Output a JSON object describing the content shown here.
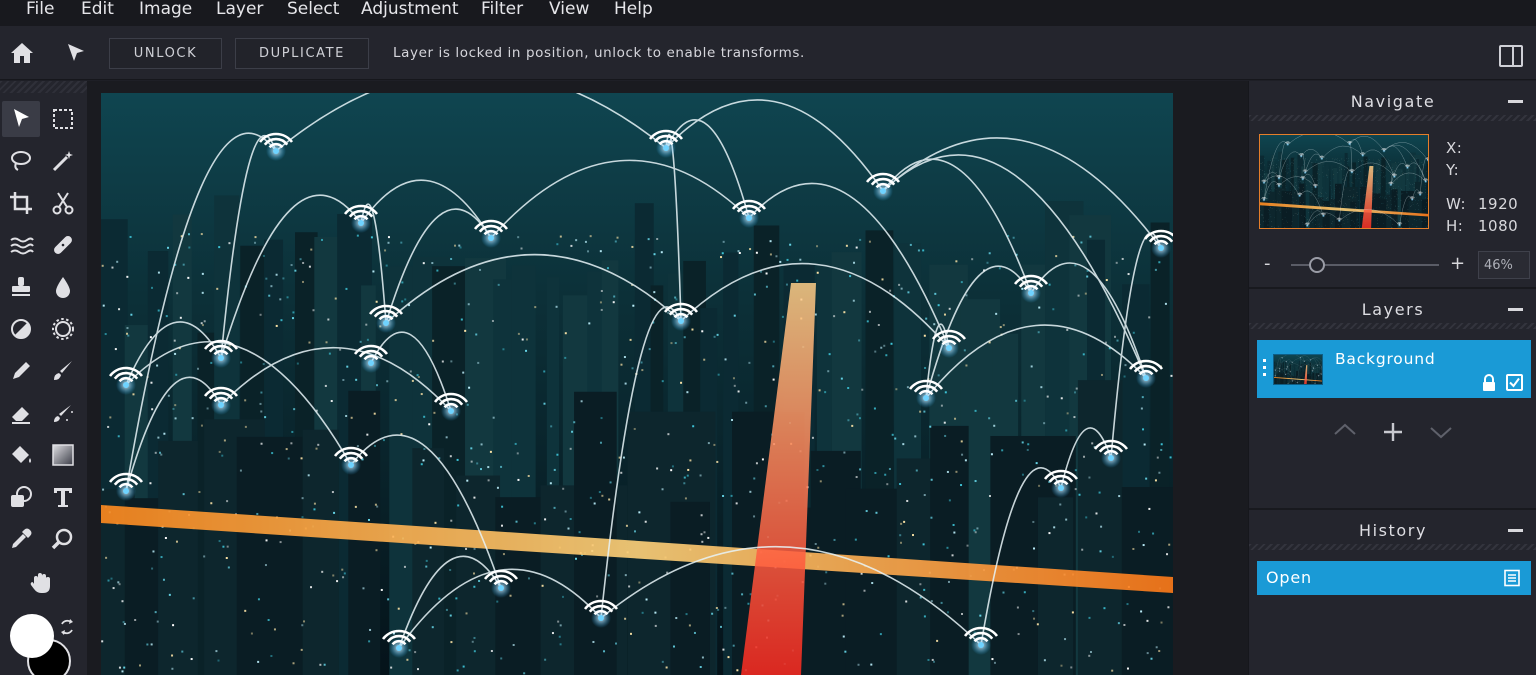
{
  "menu": [
    "File",
    "Edit",
    "Image",
    "Layer",
    "Select",
    "Adjustment",
    "Filter",
    "View",
    "Help"
  ],
  "toolbar": {
    "home_icon": "home-icon",
    "pointer_icon": "arrow-pointer-icon",
    "unlock_label": "UNLOCK",
    "duplicate_label": "DUPLICATE",
    "status_message": "Layer is locked in position, unlock to enable transforms.",
    "panel_toggle_icon": "collapse-panel-icon"
  },
  "tools": [
    "move-icon",
    "marquee-icon",
    "lasso-icon",
    "magic-wand-icon",
    "crop-icon",
    "scissors-icon",
    "liquify-icon",
    "healing-bandage-icon",
    "stamp-icon",
    "drop-icon",
    "dodge-icon",
    "sponge-icon",
    "pencil-icon",
    "brush-icon",
    "eraser-icon",
    "spray-brush-icon",
    "paint-bucket-icon",
    "gradient-icon",
    "shape-icon",
    "text-icon",
    "eyedropper-icon",
    "zoom-icon",
    "hand-icon"
  ],
  "colors": {
    "foreground": "#ffffff",
    "background": "#000000",
    "accent": "#1a9ad6",
    "thumb_border": "#e57e2a"
  },
  "navigate": {
    "title": "Navigate",
    "x_label": "X:",
    "y_label": "Y:",
    "w_label": "W:",
    "w_value": "1920",
    "h_label": "H:",
    "h_value": "1080",
    "zoom_minus": "-",
    "zoom_plus": "+",
    "zoom_value": "46%",
    "zoom_fraction": 0.46
  },
  "layers": {
    "title": "Layers",
    "items": [
      {
        "name": "Background",
        "locked": true,
        "visible": true
      }
    ]
  },
  "history": {
    "title": "History",
    "items": [
      {
        "name": "Open"
      }
    ]
  }
}
